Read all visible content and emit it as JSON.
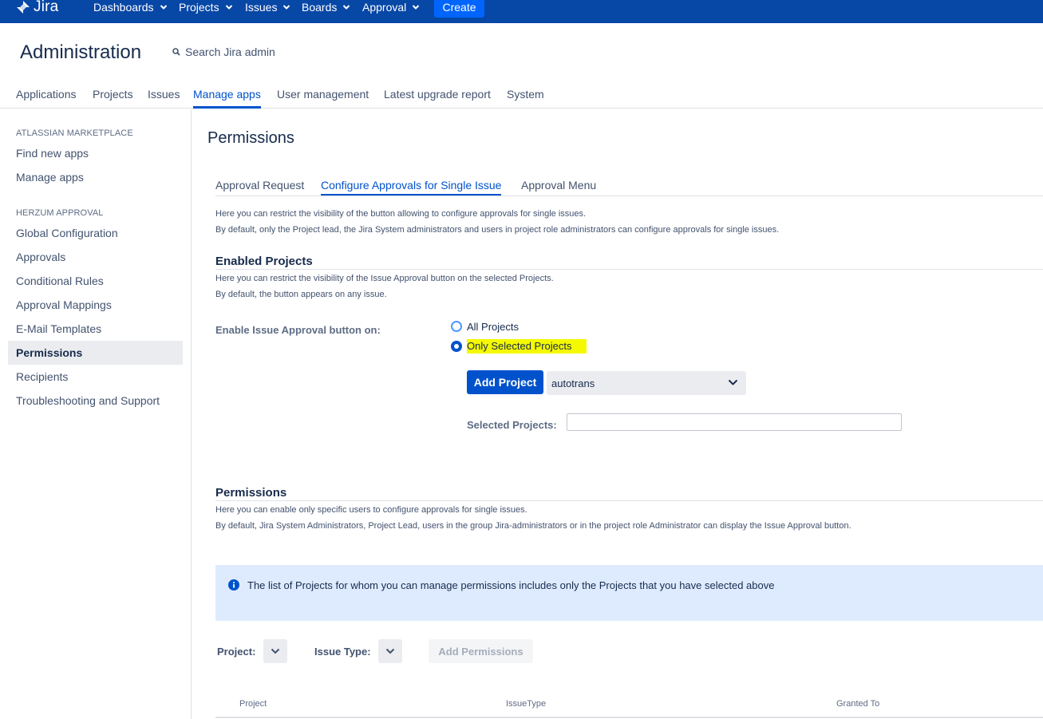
{
  "topnav": {
    "logo_text": "Jira",
    "items": [
      {
        "label": "Dashboards"
      },
      {
        "label": "Projects"
      },
      {
        "label": "Issues"
      },
      {
        "label": "Boards"
      },
      {
        "label": "Approval"
      }
    ],
    "create_label": "Create"
  },
  "header": {
    "title": "Administration",
    "search_label": "Search Jira admin"
  },
  "admin_tabs": [
    {
      "label": "Applications"
    },
    {
      "label": "Projects"
    },
    {
      "label": "Issues"
    },
    {
      "label": "Manage apps",
      "active": true
    },
    {
      "label": "User management"
    },
    {
      "label": "Latest upgrade report"
    },
    {
      "label": "System"
    }
  ],
  "sidebar": {
    "sections": [
      {
        "heading": "ATLASSIAN MARKETPLACE",
        "items": [
          {
            "label": "Find new apps"
          },
          {
            "label": "Manage apps"
          }
        ]
      },
      {
        "heading": "HERZUM APPROVAL",
        "items": [
          {
            "label": "Global Configuration"
          },
          {
            "label": "Approvals"
          },
          {
            "label": "Conditional Rules"
          },
          {
            "label": "Approval Mappings"
          },
          {
            "label": "E-Mail Templates"
          },
          {
            "label": "Permissions",
            "active": true
          },
          {
            "label": "Recipients"
          },
          {
            "label": "Troubleshooting and Support"
          }
        ]
      }
    ]
  },
  "main": {
    "title": "Permissions",
    "tabs": [
      {
        "label": "Approval Request"
      },
      {
        "label": "Configure Approvals for Single Issue",
        "active": true
      },
      {
        "label": "Approval Menu"
      }
    ],
    "intro": [
      "Here you can restrict the visibility of the button allowing to configure approvals for single issues.",
      "By default, only the Project lead, the Jira System administrators and users in project role administrators can configure approvals for single issues."
    ],
    "enabled_projects": {
      "title": "Enabled Projects",
      "desc": [
        "Here you can restrict the visibility of the Issue Approval button on the selected Projects.",
        "By default, the button appears on any issue."
      ],
      "enable_label": "Enable Issue Approval button on:",
      "options": [
        {
          "label": "All Projects",
          "selected": false
        },
        {
          "label": "Only Selected Projects",
          "selected": true
        }
      ],
      "add_project_label": "Add Project",
      "project_select_value": "autotrans",
      "selected_projects_label": "Selected Projects:",
      "selected_projects_value": ""
    },
    "permissions": {
      "title": "Permissions",
      "desc": [
        "Here you can enable only specific users to configure approvals for single issues.",
        "By default, Jira System Administrators, Project Lead, users in the group Jira-administrators or in the project role Administrator can display the Issue Approval button."
      ],
      "info": "The list of Projects for whom you can manage permissions includes only the Projects that you have selected above",
      "project_label": "Project:",
      "issue_type_label": "Issue Type:",
      "add_permissions_label": "Add Permissions",
      "table_headers": [
        "Project",
        "IssueType",
        "Granted To"
      ]
    }
  },
  "colors": {
    "topbar": "#0747a6",
    "primary": "#0052cc",
    "create_button": "#0065ff",
    "highlight": "#f5f900",
    "info_bg": "#deebff"
  }
}
